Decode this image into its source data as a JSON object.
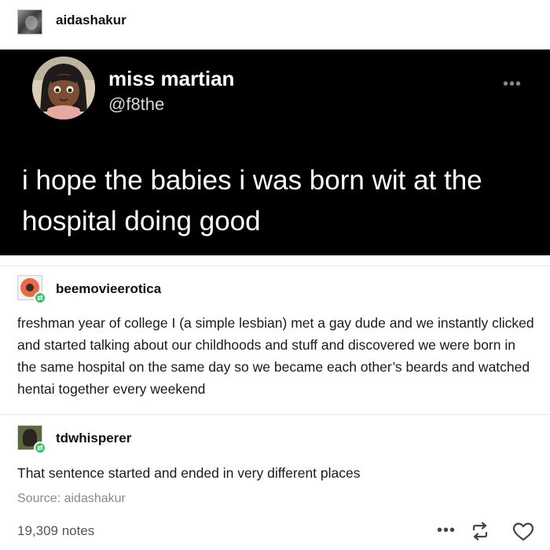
{
  "post": {
    "author": "aidashakur",
    "tweet": {
      "display_name": "miss martian",
      "handle": "@f8the",
      "more_icon": "•••",
      "text": "i hope the babies i was born wit at the hospital doing good"
    },
    "reblogs": [
      {
        "username": "beemovieerotica",
        "text": "freshman year of college I (a simple lesbian) met a gay dude and we instantly clicked and started talking about our childhoods and stuff and discovered we were born in the same hospital on the same day so we became each other’s beards and watched hentai together every weekend"
      },
      {
        "username": "tdwhisperer",
        "text": "That sentence started and ended in very different places"
      }
    ],
    "source": "Source: aidashakur",
    "notes": "19,309 notes",
    "actions": {
      "more": "•••",
      "reblog_icon": "reblog-icon",
      "like_icon": "heart-icon"
    }
  },
  "colors": {
    "reblog_badge": "#33c163",
    "tweet_bg": "#000000"
  }
}
